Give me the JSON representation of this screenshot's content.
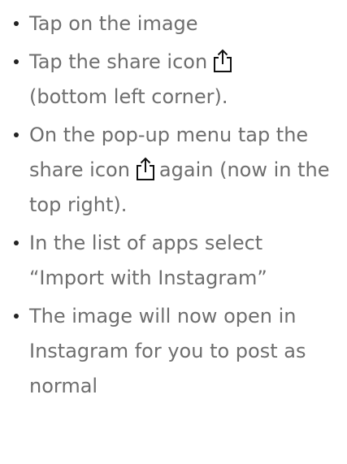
{
  "steps": [
    {
      "text_before": "Tap on the image"
    },
    {
      "text_before": "Tap the share icon",
      "icon": "share-icon",
      "text_after": "(bottom left corner)."
    },
    {
      "text_before": "On the pop-up menu tap the share icon",
      "icon": "share-icon",
      "text_after": "again (now in the top right)."
    },
    {
      "text_before": "In the list of apps select “Import with Instagram”"
    },
    {
      "text_before": "The image will now open in Instagram for you to post as normal"
    }
  ],
  "colors": {
    "text": "#6e6e6e",
    "bullet": "#222222",
    "icon": "#111111"
  }
}
